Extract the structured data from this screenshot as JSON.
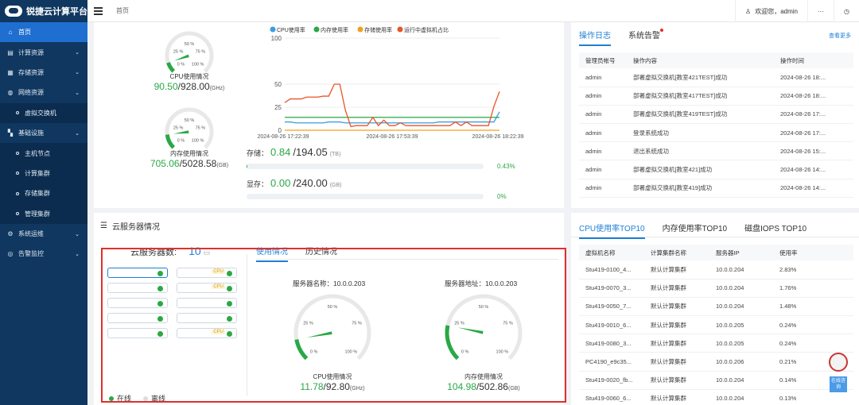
{
  "app": {
    "title": "锐捷云计算平台"
  },
  "sidebar": {
    "items": [
      {
        "label": "首页",
        "icon": "home-icon",
        "active": true,
        "sub": false,
        "chevron": false
      },
      {
        "label": "计算资源",
        "icon": "server-icon",
        "active": false,
        "sub": false,
        "chevron": true
      },
      {
        "label": "存储资源",
        "icon": "storage-icon",
        "active": false,
        "sub": false,
        "chevron": true
      },
      {
        "label": "网络资源",
        "icon": "globe-icon",
        "active": false,
        "sub": false,
        "chevron": true
      },
      {
        "label": "虚拟交换机",
        "icon": "dot",
        "active": false,
        "sub": true,
        "chevron": false
      },
      {
        "label": "基础设施",
        "icon": "grid-icon",
        "active": false,
        "sub": false,
        "chevron": true
      },
      {
        "label": "主机节点",
        "icon": "dot",
        "active": false,
        "sub": true,
        "chevron": false
      },
      {
        "label": "计算集群",
        "icon": "dot",
        "active": false,
        "sub": true,
        "chevron": false
      },
      {
        "label": "存储集群",
        "icon": "dot",
        "active": false,
        "sub": true,
        "chevron": false
      },
      {
        "label": "管理集群",
        "icon": "dot",
        "active": false,
        "sub": true,
        "chevron": false
      },
      {
        "label": "系统运维",
        "icon": "gear-icon",
        "active": false,
        "sub": false,
        "chevron": true
      },
      {
        "label": "告警监控",
        "icon": "alert-icon",
        "active": false,
        "sub": false,
        "chevron": true
      }
    ]
  },
  "topbar": {
    "breadcrumb": "首页",
    "welcome": "欢迎您，admin",
    "more": "···"
  },
  "overview": {
    "cpu_gauge": {
      "label": "CPU使用情况",
      "used": "90.50",
      "total": "/928.00",
      "unit": "(GHz)",
      "ratio": 0.0975
    },
    "mem_gauge": {
      "label": "内存使用情况",
      "used": "705.06",
      "total": "/5028.58",
      "unit": "(GB)",
      "ratio": 0.14
    },
    "gauge_ticks": [
      "0 %",
      "25 %",
      "50 %",
      "75 %",
      "100 %"
    ],
    "storage": {
      "label": "存储：",
      "used": "0.84",
      "total": "/194.05",
      "unit": "(TB)",
      "pct": "0.43%",
      "ratio": 0.0043
    },
    "vram": {
      "label": "显存：",
      "used": "0.00",
      "total": "/240.00",
      "unit": "(GB)",
      "pct": "0%",
      "ratio": 0
    }
  },
  "chart_data": {
    "type": "line",
    "x": [
      "2024-08-26 17:22:39",
      "2024-08-26 17:53:39",
      "2024-08-26 18:22:39"
    ],
    "ylim": [
      0,
      100
    ],
    "yticks": [
      0,
      25,
      50,
      100
    ],
    "series": [
      {
        "name": "CPU使用率",
        "color": "#3a9ee0",
        "values": [
          9,
          9,
          8,
          8,
          8,
          8,
          8,
          8,
          9,
          9,
          9,
          8,
          8,
          8,
          8,
          8,
          8,
          8,
          8,
          8,
          8,
          8,
          8,
          8,
          8,
          8,
          8,
          8,
          9,
          9,
          9,
          9,
          9,
          9,
          9,
          9,
          9,
          9,
          9,
          20
        ]
      },
      {
        "name": "内存使用率",
        "color": "#2aa845",
        "values": [
          14,
          14,
          14,
          14,
          14,
          14,
          14,
          14,
          14,
          14,
          14,
          14,
          14,
          14,
          14,
          14,
          14,
          14,
          14,
          14,
          14,
          14,
          14,
          14,
          14,
          14,
          14,
          14,
          14,
          14,
          14,
          14,
          14,
          14,
          14,
          14,
          14,
          14,
          14,
          14
        ]
      },
      {
        "name": "存储使用率",
        "color": "#f0a020",
        "values": [
          0,
          0,
          0,
          0,
          0,
          0,
          0,
          0,
          0,
          0,
          0,
          0,
          0,
          0,
          0,
          0,
          0,
          0,
          0,
          0,
          0,
          0,
          0,
          0,
          0,
          0,
          0,
          0,
          0,
          0,
          0,
          0,
          0,
          0,
          0,
          0,
          0,
          0,
          0,
          0
        ]
      },
      {
        "name": "运行中虚拟机占比",
        "color": "#e8542a",
        "values": [
          30,
          34,
          34,
          34,
          36,
          36,
          36,
          37,
          37,
          50,
          50,
          22,
          4,
          5,
          5,
          5,
          14,
          5,
          11,
          5,
          5,
          8,
          5,
          5,
          5,
          5,
          5,
          5,
          5,
          5,
          5,
          9,
          5,
          9,
          5,
          5,
          5,
          5,
          26,
          42
        ]
      }
    ],
    "legend_position": "top"
  },
  "log": {
    "tabs": [
      "操作日志",
      "系统告警"
    ],
    "more": "查看更多",
    "columns": [
      "管理员帐号",
      "操作内容",
      "操作时间"
    ],
    "rows": [
      [
        "admin",
        "部署虚拟交换机[教室421TEST]成功",
        "2024-08-26 18:..."
      ],
      [
        "admin",
        "部署虚拟交换机[教室417TEST]成功",
        "2024-08-26 18:..."
      ],
      [
        "admin",
        "部署虚拟交换机[教室419TEST]成功",
        "2024-08-26 17:..."
      ],
      [
        "admin",
        "登录系统成功",
        "2024-08-26 17:..."
      ],
      [
        "admin",
        "退出系统成功",
        "2024-08-26 15:..."
      ],
      [
        "admin",
        "部署虚拟交换机[教室421]成功",
        "2024-08-26 14:..."
      ],
      [
        "admin",
        "部署虚拟交换机[教室419]成功",
        "2024-08-26 14:..."
      ]
    ]
  },
  "server": {
    "title": "云服务器情况",
    "count_label": "云服务器数:",
    "count": "10",
    "tabs": [
      "使用情况",
      "历史情况"
    ],
    "cpu_badge": "CPU",
    "name_label": "服务器名称：10.0.0.203",
    "addr_label": "服务器地址：10.0.0.203",
    "cpu_gauge": {
      "label": "CPU使用情况",
      "used": "11.78",
      "total": "/92.80",
      "unit": "(GHz)",
      "ratio": 0.127
    },
    "mem_gauge": {
      "label": "内存使用情况",
      "used": "104.98",
      "total": "/502.86",
      "unit": "(GB)",
      "ratio": 0.209
    },
    "legend": {
      "online": "在线",
      "offline": "离线"
    }
  },
  "top10": {
    "tabs": [
      "CPU使用率TOP10",
      "内存使用率TOP10",
      "磁盘IOPS TOP10"
    ],
    "columns": [
      "虚拟机名称",
      "计算集群名称",
      "服务器IP",
      "使用率"
    ],
    "rows": [
      [
        "Stu419-0100_4...",
        "默认计算集群",
        "10.0.0.204",
        "2.83%"
      ],
      [
        "Stu419-0070_3...",
        "默认计算集群",
        "10.0.0.204",
        "1.76%"
      ],
      [
        "Stu419-0050_7...",
        "默认计算集群",
        "10.0.0.204",
        "1.48%"
      ],
      [
        "Stu419-0010_6...",
        "默认计算集群",
        "10.0.0.205",
        "0.24%"
      ],
      [
        "Stu419-0080_3...",
        "默认计算集群",
        "10.0.0.205",
        "0.24%"
      ],
      [
        "PC4190_e9c35...",
        "默认计算集群",
        "10.0.0.206",
        "0.21%"
      ],
      [
        "Stu419-0020_fb...",
        "默认计算集群",
        "10.0.0.204",
        "0.14%"
      ],
      [
        "Stu419-0060_6...",
        "默认计算集群",
        "10.0.0.204",
        "0.13%"
      ]
    ]
  },
  "assistant": {
    "label": "在线咨询"
  }
}
